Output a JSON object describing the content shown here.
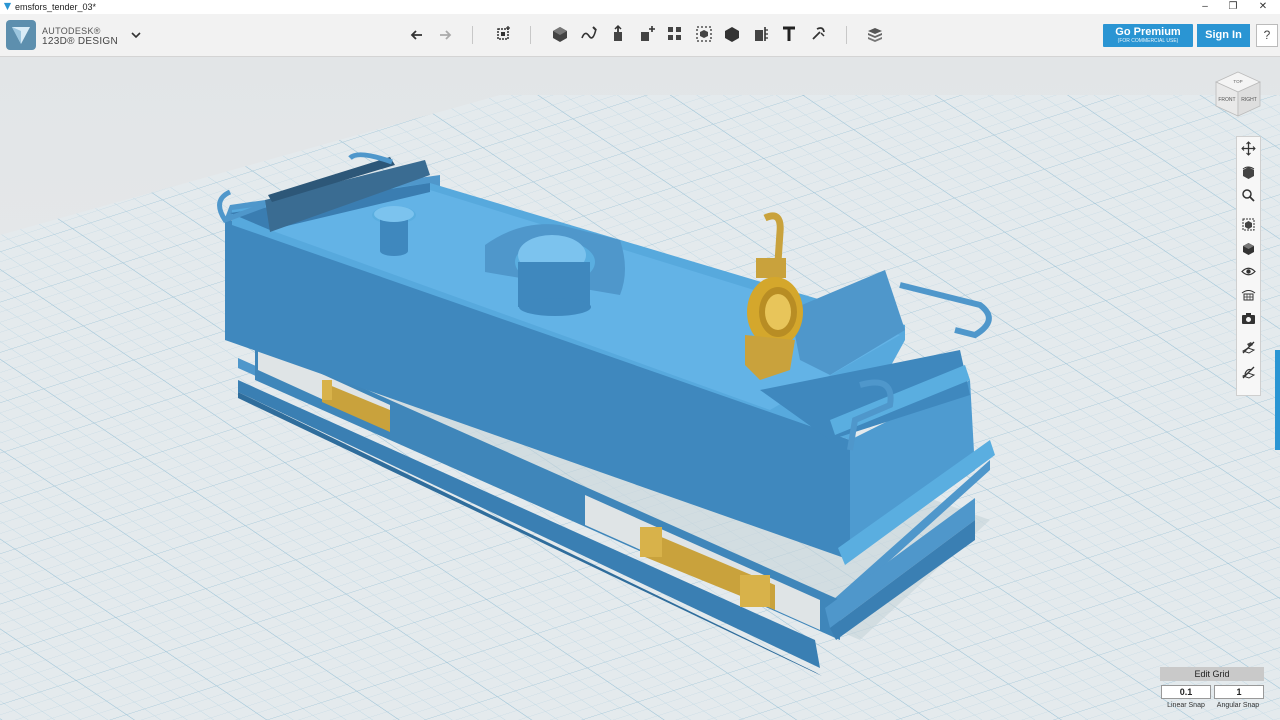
{
  "window": {
    "title": "emsfors_tender_03*",
    "minimize": "–",
    "maximize": "❐",
    "close": "✕"
  },
  "app": {
    "brand_line1": "AUTODESK®",
    "brand_line2": "123D® DESIGN"
  },
  "toolbar": {
    "icons": [
      "undo-icon",
      "redo-icon",
      "transform-icon",
      "primitives-icon",
      "sketch-icon",
      "construct-icon",
      "modify-icon",
      "pattern-icon",
      "grouping-icon",
      "combine-icon",
      "measure-icon",
      "text-icon",
      "snap-icon",
      "material-icon"
    ]
  },
  "header_buttons": {
    "premium_label": "Go Premium",
    "premium_sub": "(FOR COMMERCIAL USE)",
    "signin_label": "Sign In",
    "help_label": "?"
  },
  "viewcube": {
    "front": "FRONT",
    "right": "RIGHT",
    "top": "TOP"
  },
  "navbar": {
    "items": [
      "pan-icon",
      "orbit-icon",
      "zoom-icon",
      "fit-icon",
      "view-mode-icon",
      "visibility-icon",
      "materials-outlines-icon",
      "screenshot-icon",
      "grid-toggle-icon",
      "snap-toggle-icon"
    ]
  },
  "grid_panel": {
    "title": "Edit Grid",
    "linear_snap_value": "0.1",
    "angular_snap_value": "1",
    "linear_snap_label": "Linear Snap",
    "angular_snap_label": "Angular Snap"
  },
  "colors": {
    "accent": "#2a95d3",
    "model_blue": "#5aaee0",
    "brass": "#d4a72c",
    "grid_bg": "#e4eaed"
  }
}
